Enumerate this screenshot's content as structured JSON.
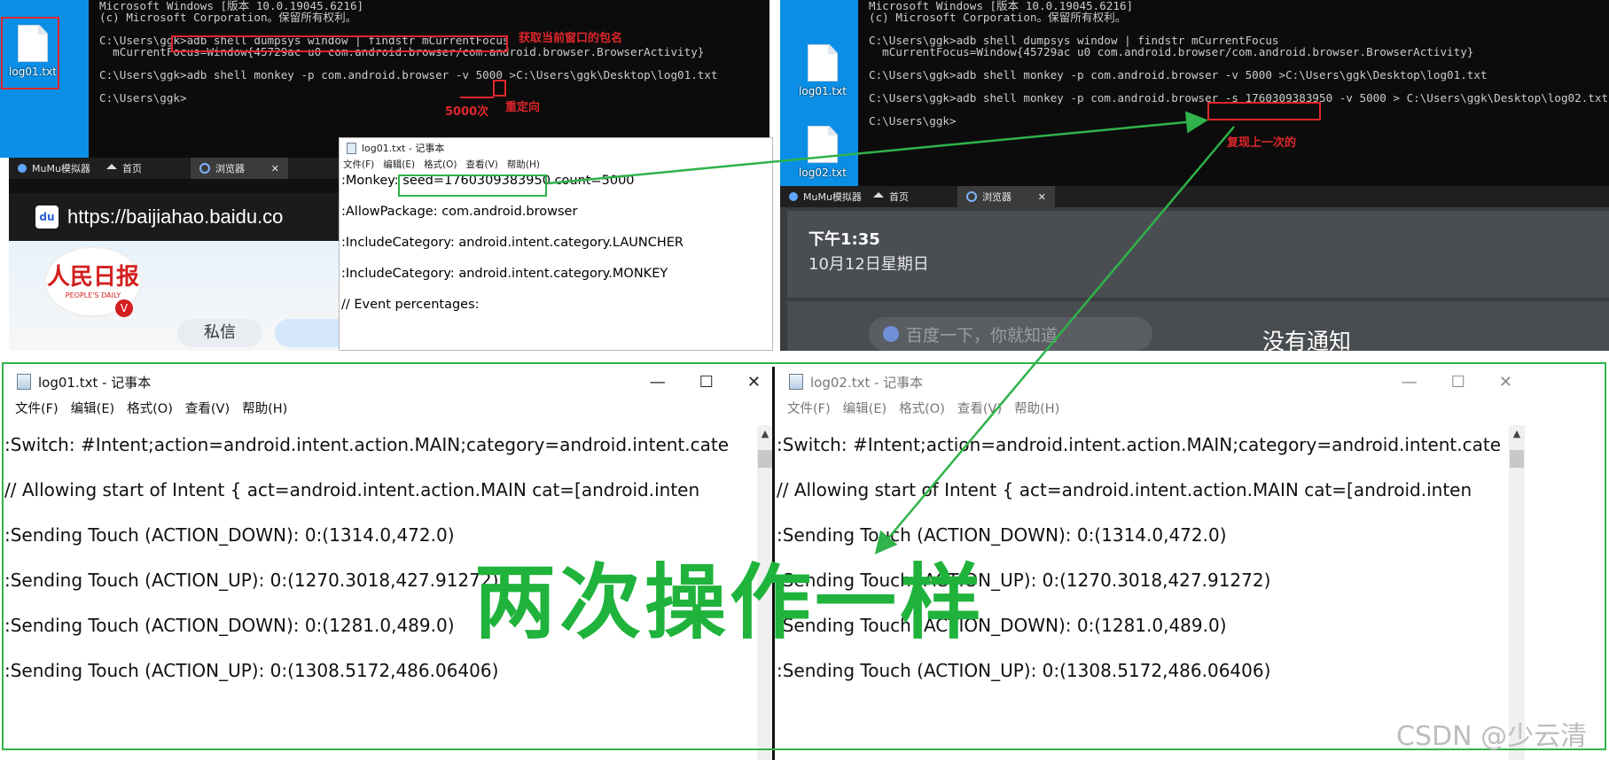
{
  "left_screenshot": {
    "desktop_icon_label": "log01.txt",
    "console_lines": [
      "Microsoft Windows [版本 10.0.19045.6216]",
      "(c) Microsoft Corporation。保留所有权利。",
      "",
      "C:\\Users\\ggk>adb shell dumpsys window | findstr mCurrentFocus",
      "  mCurrentFocus=Window{45729ac u0 com.android.browser/com.android.browser.BrowserActivity}",
      "",
      "C:\\Users\\ggk>adb shell monkey -p com.android.browser -v 5000 >C:\\Users\\ggk\\Desktop\\log01.txt",
      "",
      "C:\\Users\\ggk>"
    ],
    "annotation_pkg": "获取当前窗口的包名",
    "annotation_count": "5000次",
    "annotation_redirect": "重定向",
    "mumu": {
      "app_name": "MuMu模拟器",
      "home_tab": "首页",
      "browser_tab": "浏览器",
      "url": "https://baijiahao.baidu.co",
      "logo_text": "人民日报",
      "logo_sub": "PEOPLE'S DAILY",
      "button": "私信"
    },
    "notepad": {
      "title": "log01.txt - 记事本",
      "menu": [
        "文件(F)",
        "编辑(E)",
        "格式(O)",
        "查看(V)",
        "帮助(H)"
      ],
      "monkey_prefix": ":Monkey: ",
      "seed": "seed=1760309383950",
      "count": " count=5000",
      "lines": [
        ":AllowPackage: com.android.browser",
        ":IncludeCategory: android.intent.category.LAUNCHER",
        ":IncludeCategory: android.intent.category.MONKEY",
        "// Event percentages:"
      ]
    }
  },
  "right_screenshot": {
    "desktop_icons": [
      "log01.txt",
      "log02.txt"
    ],
    "console_lines": [
      "Microsoft Windows [版本 10.0.19045.6216]",
      "(c) Microsoft Corporation。保留所有权利。",
      "",
      "C:\\Users\\ggk>adb shell dumpsys window | findstr mCurrentFocus",
      "  mCurrentFocus=Window{45729ac u0 com.android.browser/com.android.browser.BrowserActivity}",
      "",
      "C:\\Users\\ggk>adb shell monkey -p com.android.browser -v 5000 >C:\\Users\\ggk\\Desktop\\log01.txt",
      "",
      "C:\\Users\\ggk>adb shell monkey -p com.android.browser -s 1760309383950 -v 5000 > C:\\Users\\ggk\\Desktop\\log02.txt",
      "",
      "C:\\Users\\ggk>"
    ],
    "annotation_replay": "复现上一次的",
    "mumu": {
      "app_name": "MuMu模拟器",
      "home_tab": "首页",
      "browser_tab": "浏览器",
      "time": "下午1:35",
      "date": "10月12日星期日",
      "search_hint": "百度一下，你就知道",
      "no_notice": "没有通知"
    }
  },
  "bottom_left_notepad": {
    "title": "log01.txt - 记事本",
    "menu": [
      "文件(F)",
      "编辑(E)",
      "格式(O)",
      "查看(V)",
      "帮助(H)"
    ],
    "lines": [
      ":Switch: #Intent;action=android.intent.action.MAIN;category=android.intent.cate",
      "    // Allowing start of Intent { act=android.intent.action.MAIN cat=[android.inten",
      ":Sending Touch (ACTION_DOWN): 0:(1314.0,472.0)",
      ":Sending Touch (ACTION_UP): 0:(1270.3018,427.91272)",
      ":Sending Touch (ACTION_DOWN): 0:(1281.0,489.0)",
      ":Sending Touch (ACTION_UP): 0:(1308.5172,486.06406)"
    ]
  },
  "bottom_right_notepad": {
    "title": "log02.txt - 记事本",
    "menu": [
      "文件(F)",
      "编辑(E)",
      "格式(O)",
      "查看(V)",
      "帮助(H)"
    ],
    "lines": [
      ":Switch: #Intent;action=android.intent.action.MAIN;category=android.intent.cate",
      "    // Allowing start of Intent { act=android.intent.action.MAIN cat=[android.inten",
      ":Sending Touch (ACTION_DOWN): 0:(1314.0,472.0)",
      ":Sending Touch (ACTION_UP): 0:(1270.3018,427.91272)",
      ":Sending Touch (ACTION_DOWN): 0:(1281.0,489.0)",
      ":Sending Touch (ACTION_UP): 0:(1308.5172,486.06406)"
    ]
  },
  "overlay_caption": "两次操作一样",
  "watermark": "CSDN @少云清",
  "colors": {
    "annotation_red": "#e0262b",
    "highlight_green": "#2fb34a",
    "caption_green": "#1fb33c",
    "desktop_blue": "#0b8fe6"
  }
}
